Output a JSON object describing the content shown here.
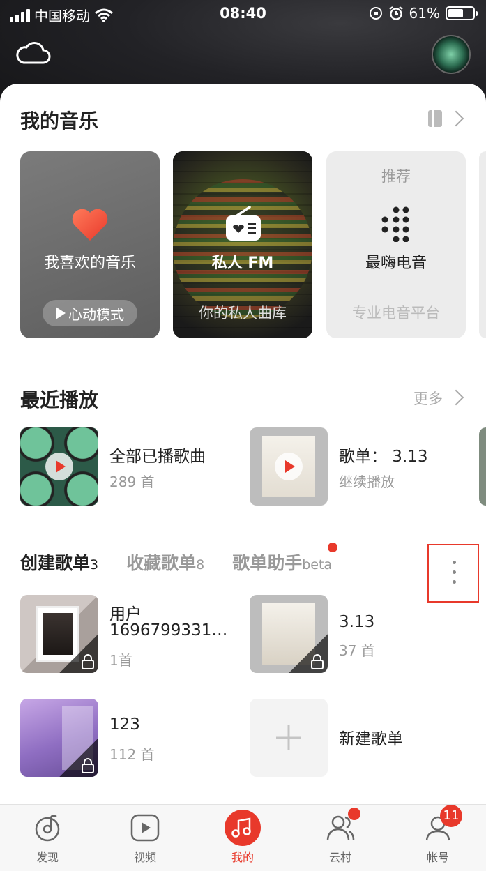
{
  "status_bar": {
    "carrier": "中国移动",
    "time": "08:40",
    "battery": "61%",
    "battery_level": 0.61
  },
  "my_music": {
    "title": "我的音乐",
    "cards": [
      {
        "label": "我喜欢的音乐",
        "mode": "心动模式"
      },
      {
        "label": "私人 FM",
        "sub": "你的私人曲库"
      },
      {
        "top": "推荐",
        "label": "最嗨电音",
        "sub": "专业电音平台"
      }
    ]
  },
  "recent": {
    "title": "最近播放",
    "more": "更多",
    "items": [
      {
        "title": "全部已播歌曲",
        "sub": "289 首"
      },
      {
        "title": "歌单： 3.13",
        "sub": "继续播放"
      }
    ]
  },
  "playlists": {
    "tabs": [
      {
        "label": "创建歌单",
        "suffix": "3"
      },
      {
        "label": "收藏歌单",
        "suffix": "8"
      },
      {
        "label": "歌单助手",
        "suffix": "beta"
      }
    ],
    "items": [
      {
        "title": "用户",
        "title2": "1696799331…",
        "sub": "1首"
      },
      {
        "title": "3.13",
        "sub": "37 首"
      },
      {
        "title": "123",
        "sub": "112 首"
      },
      {
        "title": "新建歌单"
      }
    ]
  },
  "tabbar": {
    "items": [
      {
        "label": "发现"
      },
      {
        "label": "视频"
      },
      {
        "label": "我的"
      },
      {
        "label": "云村"
      },
      {
        "label": "帐号",
        "badge": "11"
      }
    ]
  },
  "colors": {
    "accent": "#e8392b"
  }
}
